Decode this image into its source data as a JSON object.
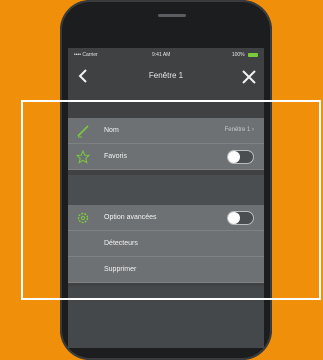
{
  "status_bar": {
    "carrier": "•••• Carrier",
    "time": "9:41 AM",
    "battery": "100%"
  },
  "nav": {
    "title": "Fenêtre 1"
  },
  "rows": {
    "name": {
      "label": "Nom",
      "value": "Fenêtre 1",
      "icon": "pencil-icon"
    },
    "favorites": {
      "label": "Favoris",
      "icon": "star-icon",
      "toggle_on": false
    },
    "advanced": {
      "label": "Option avancées",
      "icon": "gear-icon",
      "toggle_on": false
    },
    "sensors": {
      "label": "Détecteurs"
    },
    "delete": {
      "label": "Supprimer"
    }
  },
  "colors": {
    "background": "#f0900a",
    "accent": "#7acb3a",
    "screen": "#3f4143",
    "row": "#6e7173"
  }
}
